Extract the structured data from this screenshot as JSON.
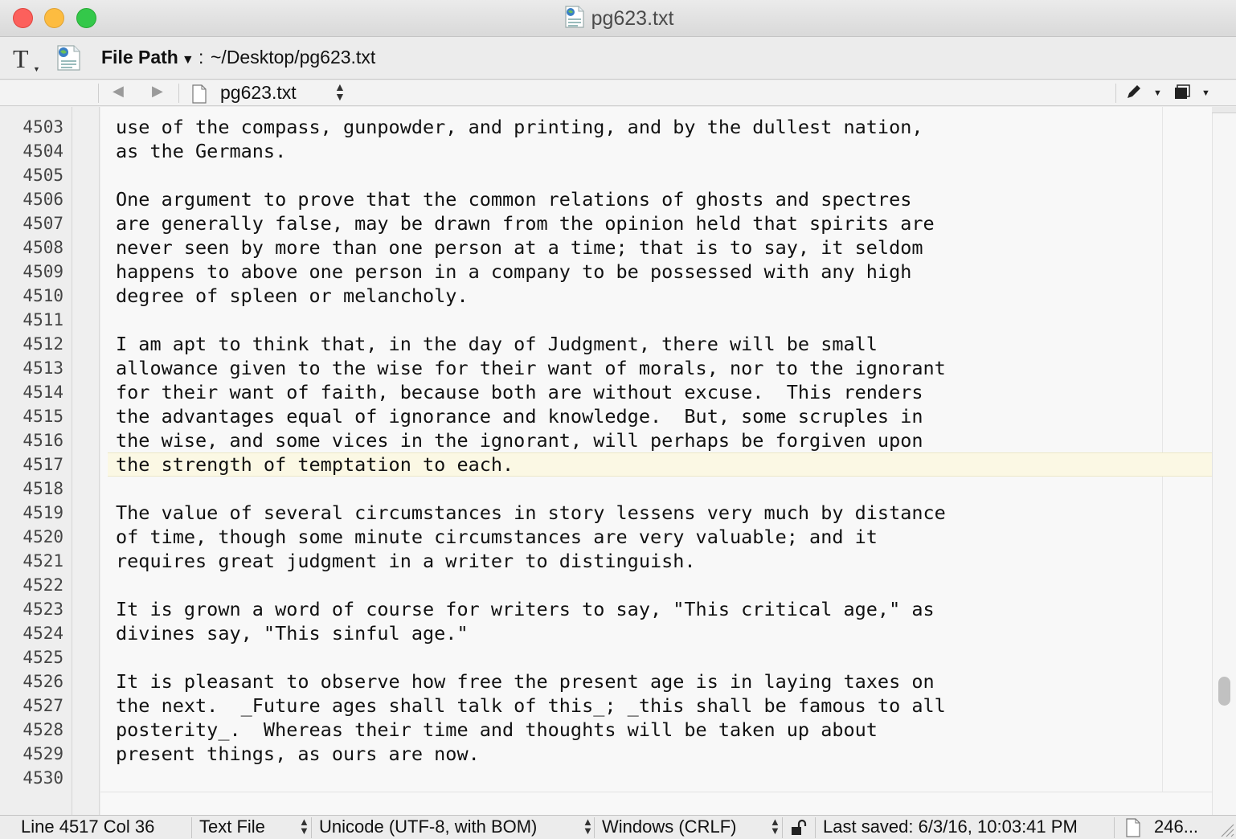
{
  "window": {
    "title": "pg623.txt"
  },
  "pathbar": {
    "label": "File Path",
    "separator": ":",
    "value": "~/Desktop/pg623.txt"
  },
  "navbar": {
    "file_name": "pg623.txt"
  },
  "editor": {
    "current_line": "4517",
    "line_numbers": [
      "4503",
      "4504",
      "4505",
      "4506",
      "4507",
      "4508",
      "4509",
      "4510",
      "4511",
      "4512",
      "4513",
      "4514",
      "4515",
      "4516",
      "4517",
      "4518",
      "4519",
      "4520",
      "4521",
      "4522",
      "4523",
      "4524",
      "4525",
      "4526",
      "4527",
      "4528",
      "4529",
      "4530"
    ],
    "lines": [
      "use of the compass, gunpowder, and printing, and by the dullest nation,",
      "as the Germans.",
      "",
      "One argument to prove that the common relations of ghosts and spectres",
      "are generally false, may be drawn from the opinion held that spirits are",
      "never seen by more than one person at a time; that is to say, it seldom",
      "happens to above one person in a company to be possessed with any high",
      "degree of spleen or melancholy.",
      "",
      "I am apt to think that, in the day of Judgment, there will be small",
      "allowance given to the wise for their want of morals, nor to the ignorant",
      "for their want of faith, because both are without excuse.  This renders",
      "the advantages equal of ignorance and knowledge.  But, some scruples in",
      "the wise, and some vices in the ignorant, will perhaps be forgiven upon",
      "the strength of temptation to each.",
      "",
      "The value of several circumstances in story lessens very much by distance",
      "of time, though some minute circumstances are very valuable; and it",
      "requires great judgment in a writer to distinguish.",
      "",
      "It is grown a word of course for writers to say, \"This critical age,\" as",
      "divines say, \"This sinful age.\"",
      "",
      "It is pleasant to observe how free the present age is in laying taxes on",
      "the next.  _Future ages shall talk of this_; _this shall be famous to all",
      "posterity_.  Whereas their time and thoughts will be taken up about",
      "present things, as ours are now.",
      ""
    ]
  },
  "statusbar": {
    "position": "Line 4517 Col 36",
    "file_type": "Text File",
    "encoding": "Unicode (UTF-8, with BOM)",
    "line_endings": "Windows (CRLF)",
    "last_saved": "Last saved: 6/3/16, 10:03:41 PM",
    "doc_info": "246..."
  },
  "colors": {
    "current_line_highlight": "#fbf8e4",
    "close_button": "#fc605c",
    "minimize_button": "#fdbc40",
    "zoom_button": "#34c84a"
  }
}
